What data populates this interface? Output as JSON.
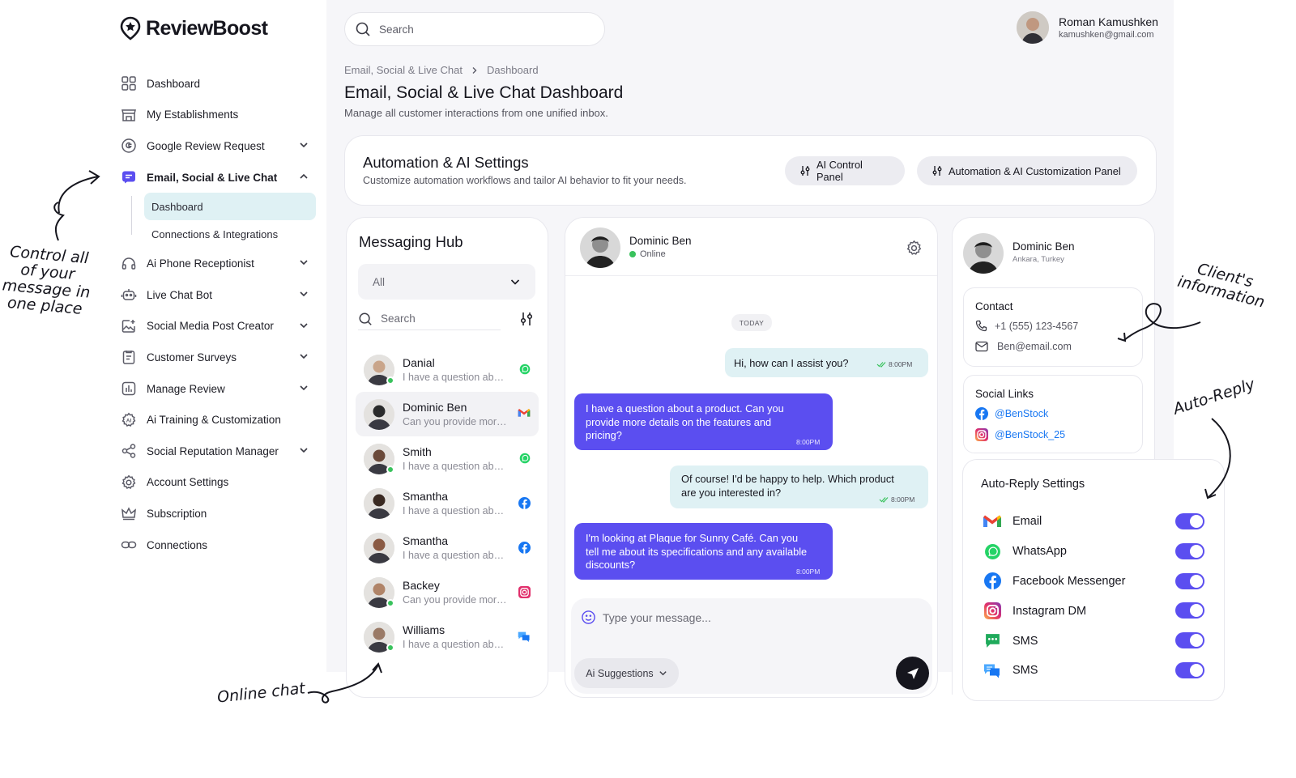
{
  "app": {
    "name": "ReviewBoost"
  },
  "sidebar": {
    "items": [
      {
        "label": "Dashboard",
        "icon": "grid-icon"
      },
      {
        "label": "My Establishments",
        "icon": "store-icon"
      },
      {
        "label": "Google Review Request",
        "icon": "google-icon",
        "chevron": "down"
      },
      {
        "label": "Email, Social & Live Chat",
        "icon": "chat-icon",
        "chevron": "up",
        "active": true
      },
      {
        "label": "Ai Phone Receptionist",
        "icon": "headset-icon",
        "chevron": "down"
      },
      {
        "label": "Live Chat Bot",
        "icon": "bot-icon",
        "chevron": "down"
      },
      {
        "label": "Social Media Post Creator",
        "icon": "image-plus-icon",
        "chevron": "down"
      },
      {
        "label": "Customer Surveys",
        "icon": "clipboard-icon",
        "chevron": "down"
      },
      {
        "label": "Manage Review",
        "icon": "bar-chart-icon",
        "chevron": "down"
      },
      {
        "label": "Ai Training & Customization",
        "icon": "ai-gear-icon"
      },
      {
        "label": "Social Reputation Manager",
        "icon": "share-icon",
        "chevron": "down"
      },
      {
        "label": "Account Settings",
        "icon": "gear-icon"
      },
      {
        "label": "Subscription",
        "icon": "crown-icon"
      },
      {
        "label": "Connections",
        "icon": "link-icon"
      }
    ],
    "sub_items": [
      {
        "label": "Dashboard",
        "selected": true
      },
      {
        "label": "Connections & Integrations"
      }
    ]
  },
  "header": {
    "search_placeholder": "Search",
    "user_name": "Roman Kamushken",
    "user_email": "kamushken@gmail.com"
  },
  "breadcrumb": {
    "parent": "Email, Social & Live Chat",
    "current": "Dashboard"
  },
  "page": {
    "title": "Email, Social & Live Chat Dashboard",
    "subtitle": "Manage all customer interactions from one unified inbox."
  },
  "automation": {
    "title": "Automation & AI Settings",
    "subtitle": "Customize automation workflows and tailor AI behavior to fit your needs.",
    "btn_control": "AI Control Panel",
    "btn_custom": "Automation & AI Customization Panel"
  },
  "hub": {
    "title": "Messaging Hub",
    "filter": "All",
    "search_placeholder": "Search",
    "conversations": [
      {
        "name": "Danial",
        "preview": "I have a question about…",
        "channel": "whatsapp",
        "online": true,
        "color": "#c9a58a"
      },
      {
        "name": "Dominic Ben",
        "preview": "Can you provide more details",
        "channel": "gmail",
        "online": false,
        "selected": true,
        "color": "#2b2b2b"
      },
      {
        "name": "Smith",
        "preview": "I have a question about…",
        "channel": "whatsapp",
        "online": true,
        "color": "#6b4a3a"
      },
      {
        "name": "Smantha",
        "preview": "I have a question about…",
        "channel": "facebook",
        "online": false,
        "color": "#3a2a22"
      },
      {
        "name": "Smantha",
        "preview": "I have a question about…",
        "channel": "facebook",
        "online": false,
        "color": "#8a5a44"
      },
      {
        "name": "Backey",
        "preview": "Can you provide more details",
        "channel": "instagram",
        "online": true,
        "color": "#b08468"
      },
      {
        "name": "Williams",
        "preview": "I have a question about…",
        "channel": "chat",
        "online": true,
        "color": "#9a7a66"
      }
    ]
  },
  "chat": {
    "contact_name": "Dominic Ben",
    "status": "Online",
    "day_label": "TODAY",
    "messages": [
      {
        "dir": "out",
        "text": "Hi, how can I assist you?",
        "time": "8:00PM"
      },
      {
        "dir": "in",
        "text": "I have a question about a product. Can you provide more details on the features and pricing?",
        "time": "8:00PM"
      },
      {
        "dir": "out",
        "text": "Of course! I'd be happy to help. Which product are you interested in?",
        "time": "8:00PM"
      },
      {
        "dir": "in",
        "text": "I'm looking at Plaque for Sunny Café. Can you tell me about its specifications and any available discounts?",
        "time": "8:00PM"
      }
    ],
    "input_placeholder": "Type your message...",
    "ai_suggestions": "Ai Suggestions"
  },
  "client": {
    "name": "Dominic Ben",
    "location": "Ankara, Turkey",
    "contact_title": "Contact",
    "phone": "+1 (555) 123-4567",
    "email": "Ben@email.com",
    "social_title": "Social Links",
    "facebook": "@BenStock",
    "instagram": "@BenStock_25"
  },
  "auto_reply": {
    "title": "Auto-Reply Settings",
    "channels": [
      {
        "label": "Email",
        "icon": "gmail-icon",
        "on": true
      },
      {
        "label": "WhatsApp",
        "icon": "whatsapp-icon",
        "on": true
      },
      {
        "label": "Facebook Messenger",
        "icon": "facebook-icon",
        "on": true
      },
      {
        "label": "Instagram DM",
        "icon": "instagram-icon",
        "on": true
      },
      {
        "label": "SMS",
        "icon": "sms-icon",
        "on": true
      },
      {
        "label": "SMS",
        "icon": "chat-bubbles-icon",
        "on": true
      }
    ]
  },
  "annotations": {
    "control": "Control all of your message in one place",
    "client": "Client's information",
    "auto_reply": "Auto-Reply",
    "online_chat": "Online chat"
  },
  "colors": {
    "accent": "#5b4ef0",
    "highlight": "#dff1f4",
    "online": "#39c25c"
  }
}
